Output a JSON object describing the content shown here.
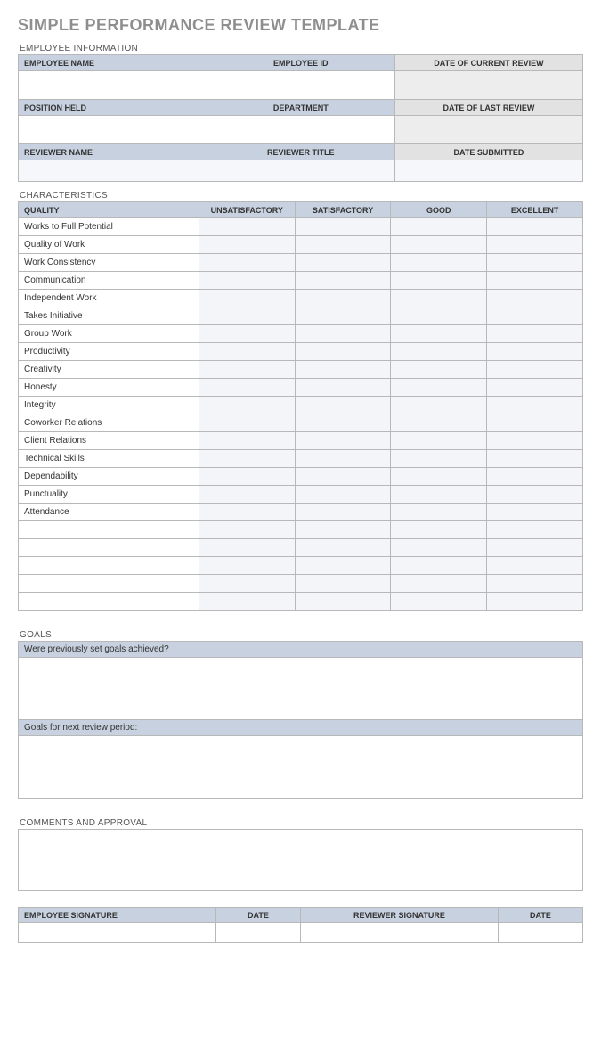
{
  "title": "SIMPLE PERFORMANCE REVIEW TEMPLATE",
  "sections": {
    "employee_info": "EMPLOYEE INFORMATION",
    "characteristics": "CHARACTERISTICS",
    "goals": "GOALS",
    "comments": "COMMENTS AND APPROVAL"
  },
  "emp": {
    "row1": {
      "c1": "EMPLOYEE NAME",
      "c2": "EMPLOYEE ID",
      "c3": "DATE OF CURRENT REVIEW"
    },
    "row2": {
      "c1": "POSITION HELD",
      "c2": "DEPARTMENT",
      "c3": "DATE OF LAST REVIEW"
    },
    "row3": {
      "c1": "REVIEWER NAME",
      "c2": "REVIEWER TITLE",
      "c3": "DATE SUBMITTED"
    }
  },
  "char_headers": {
    "quality": "QUALITY",
    "unsat": "UNSATISFACTORY",
    "sat": "SATISFACTORY",
    "good": "GOOD",
    "excellent": "EXCELLENT"
  },
  "char_rows": [
    "Works to Full Potential",
    "Quality of Work",
    "Work Consistency",
    "Communication",
    "Independent Work",
    "Takes Initiative",
    "Group Work",
    "Productivity",
    "Creativity",
    "Honesty",
    "Integrity",
    "Coworker Relations",
    "Client Relations",
    "Technical Skills",
    "Dependability",
    "Punctuality",
    "Attendance",
    "",
    "",
    "",
    "",
    ""
  ],
  "goals": {
    "prev": "Were previously set goals achieved?",
    "next": "Goals for next review period:"
  },
  "sig": {
    "emp_sig": "EMPLOYEE SIGNATURE",
    "date1": "DATE",
    "rev_sig": "REVIEWER SIGNATURE",
    "date2": "DATE"
  }
}
